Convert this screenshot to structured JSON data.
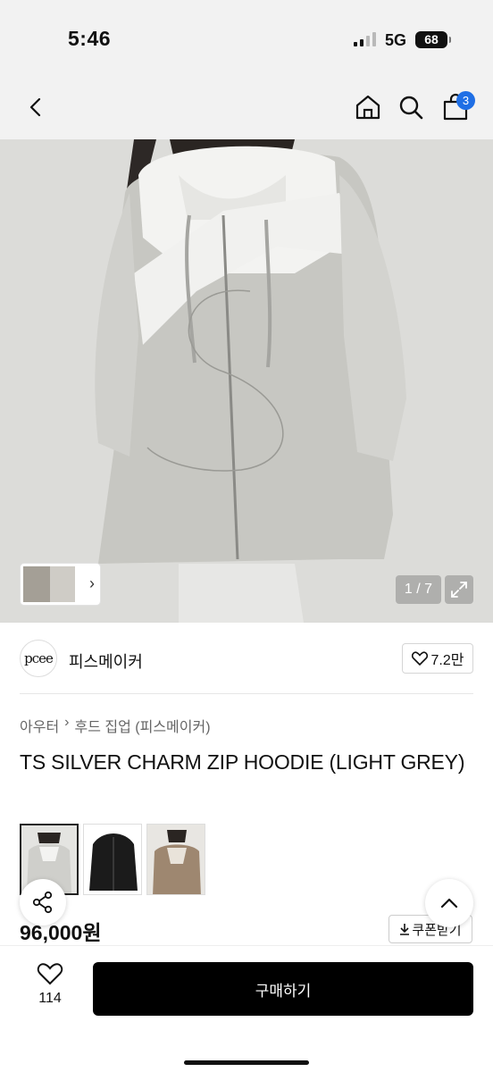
{
  "status_bar": {
    "time": "5:46",
    "network": "5G",
    "battery": "68"
  },
  "nav": {
    "back_icon": "chevron-left-icon",
    "home_icon": "home-icon",
    "search_icon": "search-icon",
    "cart_icon": "shopping-bag-icon",
    "cart_count": "3"
  },
  "gallery": {
    "counter": "1 / 7",
    "expand_icon": "expand-icon"
  },
  "brand": {
    "logo_text": "pcee",
    "name": "피스메이커",
    "likes": "7.2만"
  },
  "breadcrumb": [
    "아우터",
    "후드 집업 (피스메이커)"
  ],
  "product": {
    "title": "TS SILVER CHARM ZIP HOODIE (LIGHT GREY)",
    "price": "96,000원",
    "coupon_label": "쿠폰받기"
  },
  "variants": [
    {
      "color": "light-grey",
      "selected": true
    },
    {
      "color": "black",
      "selected": false
    },
    {
      "color": "brown",
      "selected": false
    }
  ],
  "bottom": {
    "wish_count": "114",
    "buy_label": "구매하기"
  },
  "colors": {
    "accent": "#1f6fe5",
    "buy_button": "#000000",
    "nav_bg": "#f2f2f2"
  }
}
